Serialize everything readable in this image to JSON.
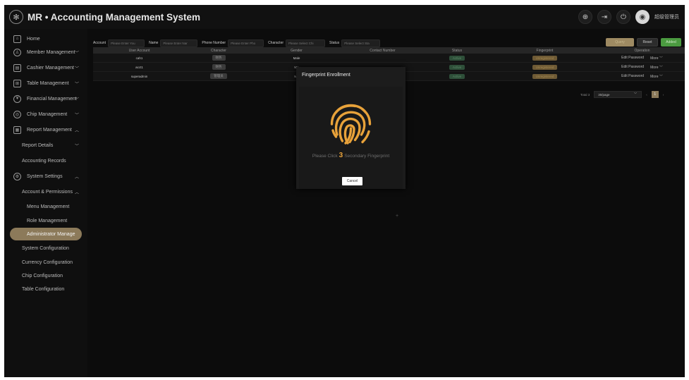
{
  "app": {
    "title": "MR • Accounting Management System",
    "logo_icon": "fingerprint-logo",
    "username": "超级管理员"
  },
  "sidebar": {
    "home": "Home",
    "member": "Member Management",
    "cashier": "Cashier Management",
    "table": "Table Management",
    "financial": "Financial Management",
    "chip": "Chip Management",
    "report": "Report Management",
    "report_details": "Report Details",
    "accounting_records": "Accounting Records",
    "system_settings": "System Settings",
    "account_permissions": "Account & Permissions",
    "menu_management": "Menu Management",
    "role_management": "Role Management",
    "administrator_manage": "Administrator Manage",
    "system_configuration": "System Configuration",
    "currency_configuration": "Currency Configuration",
    "chip_configuration": "Chip Configuration",
    "table_configuration": "Table Configuration"
  },
  "filters": {
    "account_label": "Account",
    "account_placeholder": "Please Enter You",
    "name_label": "Name",
    "name_placeholder": "Please Enter Nar",
    "phone_label": "Phone Number",
    "phone_placeholder": "Please Enter Pho",
    "character_label": "Character",
    "character_placeholder": "Please Select Chi",
    "status_label": "Status",
    "status_placeholder": "Please Select Sta",
    "query": "Query",
    "reset": "Reset",
    "add": "Added"
  },
  "table": {
    "headers": [
      "User Account",
      "Character",
      "Gender",
      "Contact Number",
      "Status",
      "Fingerprint",
      "Operation"
    ],
    "rows": [
      {
        "account": "cah1",
        "role": "财务",
        "gender": "Male",
        "contact": "",
        "status": "Active",
        "fingerprint": "Unregistered",
        "op1": "Edit Password",
        "op2": "More"
      },
      {
        "account": "acct1",
        "role": "财务",
        "gender": "Ma",
        "contact": "",
        "status": "Active",
        "fingerprint": "Unregistered",
        "op1": "Edit Password",
        "op2": "More"
      },
      {
        "account": "superadmin",
        "role": "管理员",
        "gender": "Ma",
        "contact": "",
        "status": "Active",
        "fingerprint": "Unregistered",
        "op1": "Edit Password",
        "op2": "More"
      }
    ]
  },
  "pager": {
    "total": "Total 3",
    "page_size": "30/page",
    "current": "1"
  },
  "modal": {
    "title": "Fingerprint Enrollment",
    "msg_before": "Please Click",
    "count": "3",
    "msg_after": "Secondary Fingerprint",
    "cancel": "Cancel",
    "accent_color": "#e8a23a"
  },
  "misc": {
    "plus": "+"
  }
}
